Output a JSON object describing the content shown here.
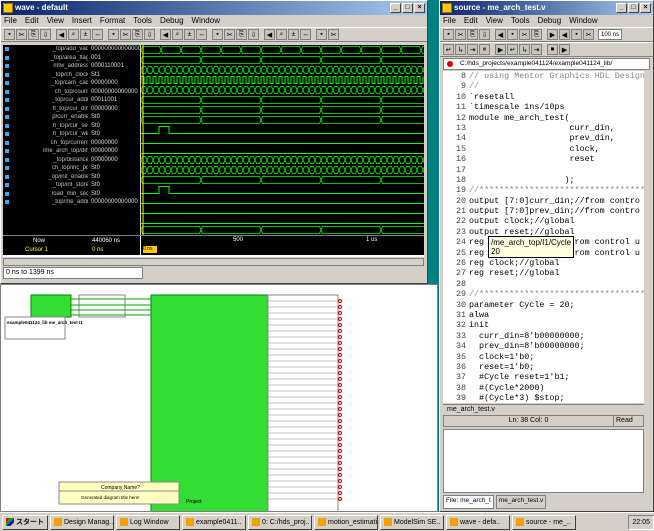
{
  "wave": {
    "title": "wave - default",
    "menu": [
      "File",
      "Edit",
      "View",
      "Insert",
      "Format",
      "Tools",
      "Debug",
      "Window"
    ],
    "signals": [
      {
        "name": "_top/add_vad",
        "value": "000000000000000"
      },
      {
        "name": "_top/area_flag",
        "value": "001"
      },
      {
        "name": "mtw_address",
        "value": "0000110001"
      },
      {
        "name": "_top/ch_clock",
        "value": "St1"
      },
      {
        "name": "_top/cam_cad",
        "value": "00000000"
      },
      {
        "name": "ch_top/count",
        "value": "00000000000000"
      },
      {
        "name": "_top/cur_addr",
        "value": "00011001"
      },
      {
        "name": "ft_top/cur_din",
        "value": "00000000"
      },
      {
        "name": "p/curr_enable",
        "value": "St0"
      },
      {
        "name": "h_top/cur_sel",
        "value": "St0"
      },
      {
        "name": "h_top/cur_we",
        "value": "St0"
      },
      {
        "name": "ch_top/current",
        "value": "00000000"
      },
      {
        "name": "/me_arch_top/diff",
        "value": "00000000"
      },
      {
        "name": "_top/distance",
        "value": "00000000"
      },
      {
        "name": "ch_top/inc_pc",
        "value": "St0"
      },
      {
        "name": "_op/init_enable",
        "value": "St0"
      },
      {
        "name": "_top/int_store",
        "value": "St0"
      },
      {
        "name": "load_min_sec",
        "value": "St0"
      },
      {
        "name": "_top/me_addr",
        "value": "00000000000000"
      }
    ],
    "now_label": "Now",
    "now_value": "440060 ns",
    "cursor_label": "Cursor 1",
    "cursor_value": "0 ns",
    "time_markers": [
      "500",
      "1 us"
    ],
    "range_label": "0 ns to 1399 ns"
  },
  "source": {
    "title": "source - me_arch_test.v",
    "menu": [
      "File",
      "Edit",
      "View",
      "Tools",
      "Debug",
      "Window"
    ],
    "zoom": "100 ns",
    "path": "C:/hds_projects/example041124/example041124_lib/",
    "lines": [
      {
        "n": "8",
        "t": "// using Mentor Graphics HDL Design",
        "c": true
      },
      {
        "n": "9",
        "t": "//",
        "c": true
      },
      {
        "n": "10",
        "t": "`resetall"
      },
      {
        "n": "11",
        "t": "`timescale 1ns/10ps"
      },
      {
        "n": "12",
        "t": "module me_arch_test("
      },
      {
        "n": "13",
        "t": "                    curr_din,"
      },
      {
        "n": "14",
        "t": "                    prev_din,"
      },
      {
        "n": "15",
        "t": "                    clock,"
      },
      {
        "n": "16",
        "t": "                    reset"
      },
      {
        "n": "17",
        "t": ""
      },
      {
        "n": "18",
        "t": "                   );"
      },
      {
        "n": "19",
        "t": "//*****************************************",
        "c": true
      },
      {
        "n": "20",
        "t": "output [7:0]curr_din;//from contro"
      },
      {
        "n": "21",
        "t": "output [7:0]prev_din;//from contro"
      },
      {
        "n": "22",
        "t": "output clock;//global"
      },
      {
        "n": "23",
        "t": "output reset;//global"
      },
      {
        "n": "24",
        "t": "reg [7:0]curr_din;//from control u"
      },
      {
        "n": "25",
        "t": "reg [7:0]prev_din;//from control u"
      },
      {
        "n": "26",
        "t": "reg clock;//global"
      },
      {
        "n": "27",
        "t": "reg reset;//global"
      },
      {
        "n": "28",
        "t": ""
      },
      {
        "n": "29",
        "t": "//*****************************************",
        "c": true
      },
      {
        "n": "30",
        "t": "parameter Cycle = 20;"
      },
      {
        "n": "31",
        "t": "alwa"
      },
      {
        "n": "32",
        "t": "init"
      },
      {
        "n": "33",
        "t": "  curr_din=8'b00000000;"
      },
      {
        "n": "34",
        "t": "  prev_din=8'b00000000;"
      },
      {
        "n": "35",
        "t": "  clock=1'b0;"
      },
      {
        "n": "36",
        "t": "  reset=1'b0;"
      },
      {
        "n": "37",
        "t": "  #Cycle reset=1'b1;"
      },
      {
        "n": "38",
        "t": "  #(Cycle*2000)"
      },
      {
        "n": "39",
        "t": "  #(Cycle*3) $stop;"
      },
      {
        "n": "40",
        "t": "  #(Cycle*5) $finish;"
      }
    ],
    "tooltip_line1": "/me_arch_top/I1/Cycle",
    "tooltip_line2": "20",
    "tab": "me_arch_test.v",
    "status": "Ln: 38 Col: 0",
    "status2": "Read",
    "bottom_tabs": [
      "File: me_arch_t",
      "me_arch_test.v"
    ]
  },
  "schematic": {
    "title_block": "Company Name?",
    "title_block2": "Generated diagram title here!",
    "project_label": "Project",
    "instance_label": "example041124_lib\nme_arch_test\nI1"
  },
  "taskbar": {
    "start": "スタート",
    "items": [
      "Design Manag..",
      "Log Window",
      "example0411..",
      "0: C:/hds_proj..",
      "motion_estimati..",
      "ModelSim SE..",
      "wave - defa..",
      "source - me_.."
    ],
    "time": "22:05"
  }
}
